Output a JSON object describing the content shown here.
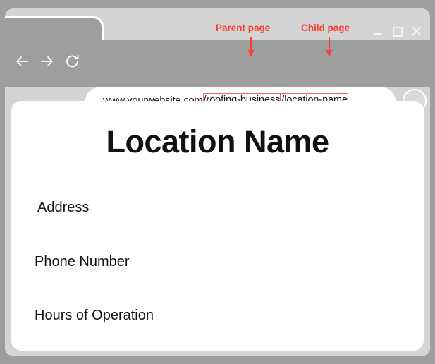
{
  "browser": {
    "tab": {
      "title": ""
    },
    "window_controls": [
      {
        "name": "minimize",
        "glyph": "–"
      },
      {
        "name": "maximize",
        "glyph": "□"
      },
      {
        "name": "close",
        "glyph": "×"
      }
    ],
    "nav": {
      "back_icon": "arrow-left-icon",
      "forward_icon": "arrow-right-icon",
      "reload_icon": "reload-icon"
    },
    "url": {
      "domain": "www.yourwebsite.com",
      "parent_segment": "/roofing-business",
      "child_segment": "/location-name",
      "full": "www.yourwebsite.com/roofing-business/location-name"
    },
    "avatar": {
      "icon": "profile-avatar-icon"
    }
  },
  "annotations": {
    "color": "#fc3b33",
    "parent": {
      "label": "Parent page",
      "points_to": "/roofing-business"
    },
    "child": {
      "label": "Child page",
      "points_to": "/location-name"
    }
  },
  "page": {
    "title": "Location Name",
    "lines": [
      {
        "label": "Address"
      },
      {
        "label": "Phone Number"
      },
      {
        "label": "Hours of Operation"
      }
    ]
  }
}
